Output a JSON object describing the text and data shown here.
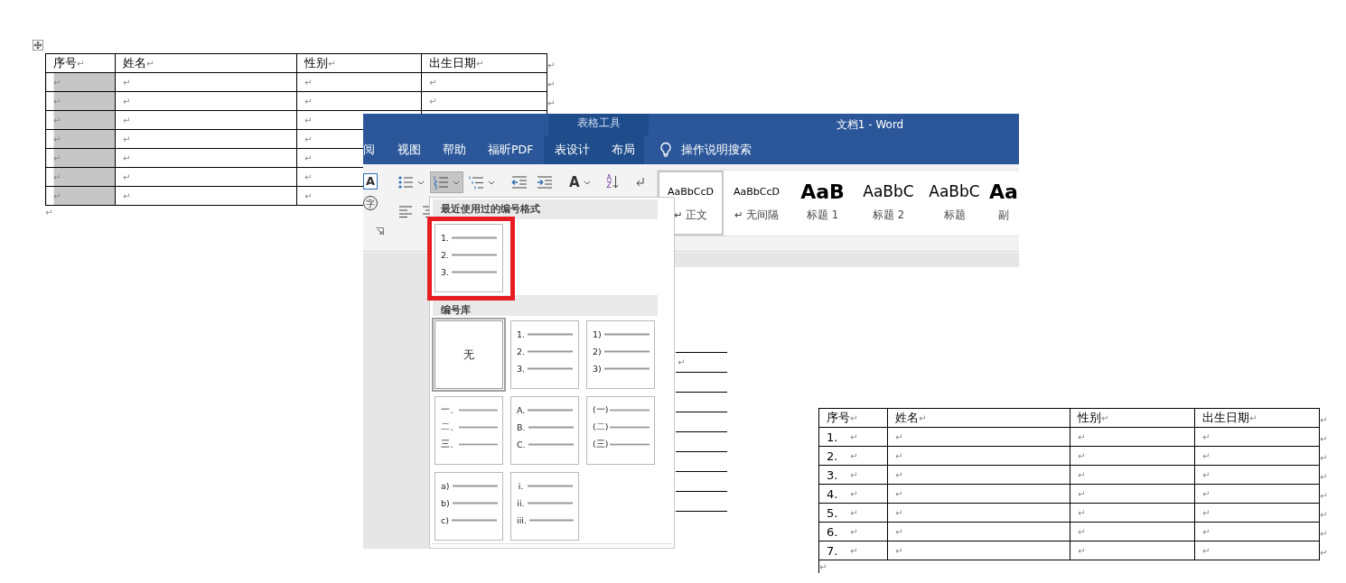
{
  "document_before": {
    "header": [
      {
        "text": "序号",
        "mark": "↵"
      },
      {
        "text": "姓名",
        "mark": "↵"
      },
      {
        "text": "性别",
        "mark": "↵"
      },
      {
        "text": "出生日期",
        "mark": "↵"
      }
    ],
    "header_end_mark": "↵",
    "rows": [
      {
        "cells": [
          {
            "mark": "↵",
            "selected": true
          },
          {
            "mark": "↵",
            "selected": false
          },
          {
            "mark": "↵",
            "selected": false
          },
          {
            "mark": "↵",
            "selected": false
          }
        ],
        "end_mark": "↵"
      },
      {
        "cells": [
          {
            "mark": "↵",
            "selected": true
          },
          {
            "mark": "↵",
            "selected": false
          },
          {
            "mark": "↵",
            "selected": false
          },
          {
            "mark": "↵",
            "selected": false
          }
        ],
        "end_mark": "↵"
      },
      {
        "cells": [
          {
            "mark": "↵",
            "selected": true
          },
          {
            "mark": "↵",
            "selected": false
          },
          {
            "mark": "↵",
            "selected": false
          }
        ]
      },
      {
        "cells": [
          {
            "mark": "↵",
            "selected": true
          },
          {
            "mark": "↵",
            "selected": false
          },
          {
            "mark": "↵",
            "selected": false
          }
        ]
      },
      {
        "cells": [
          {
            "mark": "↵",
            "selected": true
          },
          {
            "mark": "↵",
            "selected": false
          },
          {
            "mark": "↵",
            "selected": false
          }
        ]
      },
      {
        "cells": [
          {
            "mark": "↵",
            "selected": true
          },
          {
            "mark": "↵",
            "selected": false
          },
          {
            "mark": "↵",
            "selected": false
          }
        ]
      },
      {
        "cells": [
          {
            "mark": "↵",
            "selected": true
          },
          {
            "mark": "↵",
            "selected": false
          },
          {
            "mark": "↵",
            "selected": false
          }
        ]
      }
    ],
    "after_mark": "↵"
  },
  "word_window": {
    "context_title": "表格工具",
    "title": "文档1 - Word",
    "tabs": [
      {
        "label": "阅",
        "context": false
      },
      {
        "label": "视图",
        "context": false
      },
      {
        "label": "帮助",
        "context": false
      },
      {
        "label": "福昕PDF",
        "context": false
      },
      {
        "label": "表设计",
        "context": true
      },
      {
        "label": "布局",
        "context": true
      }
    ],
    "search": "操作说明搜索",
    "glyphs": {
      "font_box": "A",
      "enclose": "字",
      "spacing": "A",
      "sort_top": "A",
      "sort_bottom": "Z"
    },
    "styles": [
      {
        "preview": "AaBbCcD",
        "label": "↵ 正文",
        "kind": "normal",
        "selected": true
      },
      {
        "preview": "AaBbCcD",
        "label": "↵ 无间隔",
        "kind": "normal",
        "selected": false
      },
      {
        "preview": "AaB",
        "label": "标题 1",
        "kind": "heading1",
        "selected": false
      },
      {
        "preview": "AaBbC",
        "label": "标题 2",
        "kind": "heading2",
        "selected": false
      },
      {
        "preview": "AaBbC",
        "label": "标题",
        "kind": "heading2",
        "selected": false
      },
      {
        "preview": "Aa",
        "label": "副",
        "kind": "heading1",
        "selected": false
      }
    ],
    "numbering_menu": {
      "recent_heading": "最近使用过的编号格式",
      "recent": [
        {
          "kind": "list",
          "labels": [
            "1.",
            "2.",
            "3."
          ],
          "highlighted": true
        }
      ],
      "library_heading": "编号库",
      "library": [
        {
          "kind": "none",
          "label": "无",
          "selected": true
        },
        {
          "kind": "list",
          "labels": [
            "1.",
            "2.",
            "3."
          ],
          "selected": false
        },
        {
          "kind": "list",
          "labels": [
            "1)",
            "2)",
            "3)"
          ],
          "selected": false
        },
        {
          "kind": "list",
          "labels": [
            "一、",
            "二、",
            "三、"
          ],
          "selected": false
        },
        {
          "kind": "list",
          "labels": [
            "A.",
            "B.",
            "C."
          ],
          "selected": false
        },
        {
          "kind": "list",
          "labels": [
            "(一)",
            "(二)",
            "(三)"
          ],
          "selected": false
        },
        {
          "kind": "list",
          "labels": [
            "a)",
            "b)",
            "c)"
          ],
          "selected": false
        },
        {
          "kind": "list",
          "labels": [
            "i.",
            "ii.",
            "iii."
          ],
          "selected": false
        }
      ]
    },
    "background_mark": "↵"
  },
  "document_after": {
    "header": [
      {
        "text": "序号",
        "mark": "↵"
      },
      {
        "text": "姓名",
        "mark": "↵"
      },
      {
        "text": "性别",
        "mark": "↵"
      },
      {
        "text": "出生日期",
        "mark": "↵"
      }
    ],
    "header_end_mark": "↵",
    "rows": [
      {
        "cells": [
          {
            "text": "1.",
            "mark": "↵"
          },
          {
            "mark": "↵"
          },
          {
            "mark": "↵"
          },
          {
            "mark": "↵"
          }
        ],
        "end_mark": "↵"
      },
      {
        "cells": [
          {
            "text": "2.",
            "mark": "↵"
          },
          {
            "mark": "↵"
          },
          {
            "mark": "↵"
          },
          {
            "mark": "↵"
          }
        ],
        "end_mark": "↵"
      },
      {
        "cells": [
          {
            "text": "3.",
            "mark": "↵"
          },
          {
            "mark": "↵"
          },
          {
            "mark": "↵"
          },
          {
            "mark": "↵"
          }
        ],
        "end_mark": "↵"
      },
      {
        "cells": [
          {
            "text": "4.",
            "mark": "↵"
          },
          {
            "mark": "↵"
          },
          {
            "mark": "↵"
          },
          {
            "mark": "↵"
          }
        ],
        "end_mark": "↵"
      },
      {
        "cells": [
          {
            "text": "5.",
            "mark": "↵"
          },
          {
            "mark": "↵"
          },
          {
            "mark": "↵"
          },
          {
            "mark": "↵"
          }
        ],
        "end_mark": "↵"
      },
      {
        "cells": [
          {
            "text": "6.",
            "mark": "↵"
          },
          {
            "mark": "↵"
          },
          {
            "mark": "↵"
          },
          {
            "mark": "↵"
          }
        ],
        "end_mark": "↵"
      },
      {
        "cells": [
          {
            "text": "7.",
            "mark": "↵"
          },
          {
            "mark": "↵"
          },
          {
            "mark": "↵"
          },
          {
            "mark": "↵"
          }
        ],
        "end_mark": "↵"
      }
    ],
    "after_mark": "↵"
  }
}
